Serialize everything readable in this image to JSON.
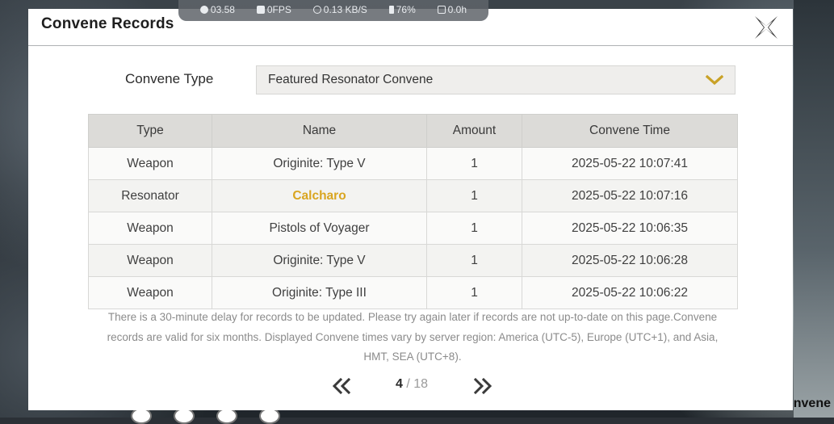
{
  "stats": {
    "clock": "03.58",
    "fps": "0FPS",
    "network": "0.13 KB/S",
    "battery": "76%",
    "timer": "0.0h"
  },
  "modal": {
    "title": "Convene Records"
  },
  "filter": {
    "label": "Convene Type",
    "selected": "Featured Resonator Convene"
  },
  "table": {
    "headers": [
      "Type",
      "Name",
      "Amount",
      "Convene Time"
    ],
    "rows": [
      {
        "type": "Weapon",
        "name": "Originite: Type V",
        "amount": "1",
        "time": "2025-05-22 10:07:41",
        "highlight": false
      },
      {
        "type": "Resonator",
        "name": "Calcharo",
        "amount": "1",
        "time": "2025-05-22 10:07:16",
        "highlight": true
      },
      {
        "type": "Weapon",
        "name": "Pistols of Voyager",
        "amount": "1",
        "time": "2025-05-22 10:06:35",
        "highlight": false
      },
      {
        "type": "Weapon",
        "name": "Originite: Type V",
        "amount": "1",
        "time": "2025-05-22 10:06:28",
        "highlight": false
      },
      {
        "type": "Weapon",
        "name": "Originite: Type III",
        "amount": "1",
        "time": "2025-05-22 10:06:22",
        "highlight": false
      }
    ]
  },
  "note": "There is a 30-minute delay for records to be updated. Please try again later if records are not up-to-date on this page.Convene records are valid for six months. Displayed Convene times vary by server region: America (UTC-5), Europe (UTC+1), and Asia, HMT, SEA (UTC+8).",
  "pagination": {
    "current": "4",
    "separator": " / ",
    "total": "18"
  },
  "background": {
    "label": "Convene"
  },
  "colors": {
    "highlight": "#d9a520",
    "chevron": "#c9a227"
  }
}
